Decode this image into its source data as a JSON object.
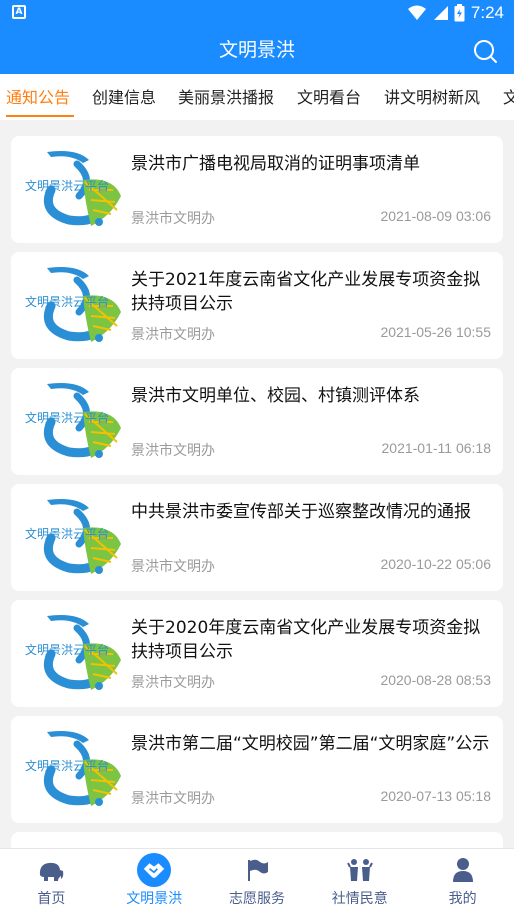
{
  "status_bar": {
    "time": "7:24",
    "left_badge": "A"
  },
  "app_bar": {
    "title": "文明景洪",
    "search_icon": "search-icon"
  },
  "tabs": [
    {
      "label": "通知公告",
      "active": true
    },
    {
      "label": "创建信息",
      "active": false
    },
    {
      "label": "美丽景洪播报",
      "active": false
    },
    {
      "label": "文明看台",
      "active": false
    },
    {
      "label": "讲文明树新风",
      "active": false
    },
    {
      "label": "文",
      "active": false
    }
  ],
  "articles": [
    {
      "title": "景洪市广播电视局取消的证明事项清单",
      "source": "景洪市文明办",
      "date": "2021-08-09 03:06",
      "logo_text": "文明景洪云平台"
    },
    {
      "title": "关于2021年度云南省文化产业发展专项资金拟扶持项目公示",
      "source": "景洪市文明办",
      "date": "2021-05-26 10:55",
      "logo_text": "文明景洪云平台"
    },
    {
      "title": "景洪市文明单位、校园、村镇测评体系",
      "source": "景洪市文明办",
      "date": "2021-01-11 06:18",
      "logo_text": "文明景洪云平台"
    },
    {
      "title": "中共景洪市委宣传部关于巡察整改情况的通报",
      "source": "景洪市文明办",
      "date": "2020-10-22 05:06",
      "logo_text": "文明景洪云平台"
    },
    {
      "title": "关于2020年度云南省文化产业发展专项资金拟扶持项目公示",
      "source": "景洪市文明办",
      "date": "2020-08-28 08:53",
      "logo_text": "文明景洪云平台"
    },
    {
      "title": "景洪市第二届“文明校园”第二届“文明家庭”公示",
      "source": "景洪市文明办",
      "date": "2020-07-13 05:18",
      "logo_text": "文明景洪云平台"
    }
  ],
  "bottom_nav": [
    {
      "label": "首页",
      "icon": "elephant-icon",
      "active": false
    },
    {
      "label": "文明景洪",
      "icon": "handshake-icon",
      "active": true
    },
    {
      "label": "志愿服务",
      "icon": "flag-icon",
      "active": false
    },
    {
      "label": "社情民意",
      "icon": "people-icon",
      "active": false
    },
    {
      "label": "我的",
      "icon": "user-icon",
      "active": false
    }
  ],
  "colors": {
    "primary": "#1a8cff",
    "tab_active": "#ff7f11",
    "nav_inactive": "#4a5e8c",
    "logo_blue": "#2a8fd4",
    "logo_green": "#7cc443",
    "logo_yellow": "#f2c200"
  }
}
